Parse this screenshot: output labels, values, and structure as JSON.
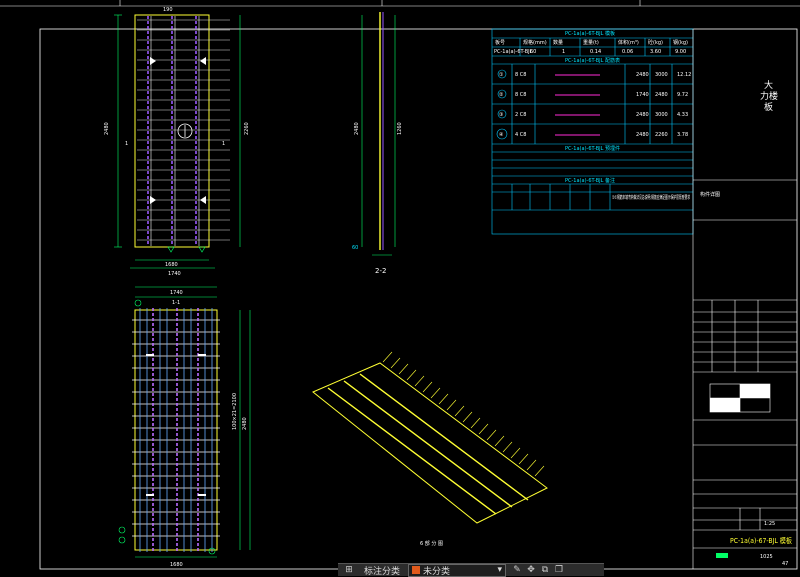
{
  "toolbar": {
    "annot_label": "标注分类",
    "layer_value": "未分类",
    "dropdown_caret": "▾",
    "icons": [
      "grid-icon",
      "dropdown-caret-icon",
      "edit-icon",
      "move-icon",
      "copy-icon",
      "paste-icon"
    ]
  },
  "drawing": {
    "title_block": {
      "sheet_title": "PC-1a(a)-67-BJL 模板",
      "sub_title_cn": "大力楼板",
      "project_label": "构件详图",
      "scale_label": "1:25",
      "page_num": "47",
      "ref_code": "1025"
    },
    "views": {
      "elevation_title": "1-1",
      "section_title": "2-2",
      "iso_title": "6 部 分 图",
      "side_dim": "1260"
    },
    "tables": {
      "header": "PC-1a(a)-6T-BJL 模板",
      "sub_header": "PC-1a(a)-6T-BJL 配筋表",
      "sub_header2": "PC-1a(a)-6T-BJL 预埋件",
      "sub_header3": "PC-1a(a)-6T-BJL 备注",
      "cols": [
        "板号",
        "规格(mm)",
        "数量",
        "重量(t)",
        "体积(m³)",
        "砼(kg)",
        "钢(kg)"
      ],
      "row1": [
        "PC-1a(a)-6T-BJL",
        "60",
        "1",
        "0.14",
        "0.06",
        "3.60",
        "9.00"
      ],
      "rebar_rows": [
        [
          "①",
          "8 C8",
          "2480",
          "3000",
          "12.12"
        ],
        [
          "②",
          "8 C8",
          "1740",
          "2480",
          "9.72"
        ],
        [
          "③",
          "2 C8",
          "2480",
          "3000",
          "4.33"
        ],
        [
          "④",
          "4 C8",
          "2480",
          "2260",
          "3.78"
        ]
      ],
      "note_text": "①①钢筋末端弯钩做法见总说明;钢筋应满足图示保护层厚度要求"
    }
  }
}
